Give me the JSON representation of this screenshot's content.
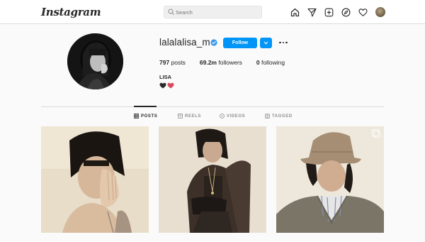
{
  "header": {
    "logo": "Instagram",
    "search": {
      "placeholder": "Search"
    },
    "nav_icons": [
      "home-icon",
      "direct-icon",
      "new-post-icon",
      "explore-icon",
      "activity-heart-icon",
      "profile-avatar"
    ]
  },
  "profile": {
    "username": "lalalalisa_m",
    "verified": true,
    "follow_label": "Follow",
    "stats": {
      "posts_count": "797",
      "posts_label": "posts",
      "followers_count": "69.2m",
      "followers_label": "followers",
      "following_count": "0",
      "following_label": "following"
    },
    "full_name": "LISA",
    "bio_icons": [
      "black-heart-icon",
      "red-heart-icon"
    ]
  },
  "tabs": [
    {
      "label": "POSTS",
      "icon": "grid-icon",
      "active": true
    },
    {
      "label": "REELS",
      "icon": "reels-icon",
      "active": false
    },
    {
      "label": "VIDEOS",
      "icon": "videos-icon",
      "active": false
    },
    {
      "label": "TAGGED",
      "icon": "tagged-icon",
      "active": false
    }
  ],
  "posts": [
    {
      "name": "post-1",
      "multi": false
    },
    {
      "name": "post-2",
      "multi": false
    },
    {
      "name": "post-3",
      "multi": true
    }
  ],
  "colors": {
    "accent": "#0095f6",
    "text": "#262626",
    "muted": "#8e8e8e",
    "border": "#dbdbdb",
    "background": "#fafafa"
  }
}
